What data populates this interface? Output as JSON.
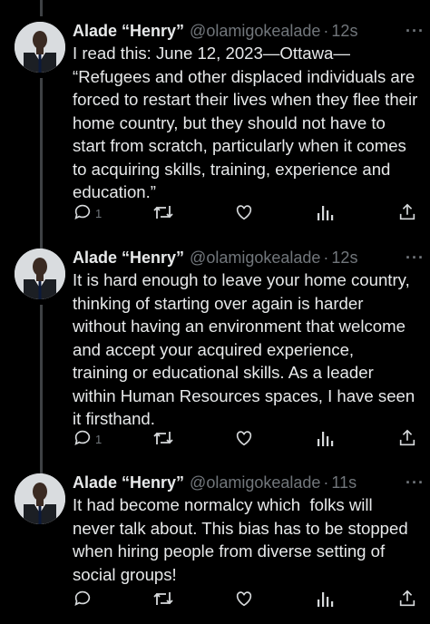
{
  "tweets": [
    {
      "display_name": "Alade “Henry”",
      "handle": "@olamigokealade",
      "separator": "·",
      "time": "12s",
      "more": "···",
      "text": "I read this: June 12, 2023—Ottawa—\n“Refugees and other displaced individuals are\nforced to restart their lives when they flee their\nhome country, but they should not have to\nstart from scratch, particularly when it comes\nto acquiring skills, training, experience and\neducation.”",
      "reply_count": "1",
      "icons": [
        "reply-icon",
        "retweet-icon",
        "like-icon",
        "views-icon",
        "share-icon"
      ]
    },
    {
      "display_name": "Alade “Henry”",
      "handle": "@olamigokealade",
      "separator": "·",
      "time": "12s",
      "more": "···",
      "text": "It is hard enough to leave your home country,\nthinking of starting over again is harder\nwithout having an environment that welcome\nand accept your acquired experience,\ntraining or educational skills. As a leader\nwithin Human Resources spaces, I have seen\nit firsthand.",
      "reply_count": "1",
      "icons": [
        "reply-icon",
        "retweet-icon",
        "like-icon",
        "views-icon",
        "share-icon"
      ]
    },
    {
      "display_name": "Alade “Henry”",
      "handle": "@olamigokealade",
      "separator": "·",
      "time": "11s",
      "more": "···",
      "text": "It had become normalcy which  folks will\nnever talk about. This bias has to be stopped\nwhen hiring people from diverse setting of\nsocial groups!",
      "reply_count": "",
      "icons": [
        "reply-icon",
        "retweet-icon",
        "like-icon",
        "views-icon",
        "share-icon"
      ]
    }
  ],
  "colors": {
    "background": "#000000",
    "text": "#e7e9ea",
    "secondary": "#71767b",
    "thread_line": "#3e4144"
  }
}
